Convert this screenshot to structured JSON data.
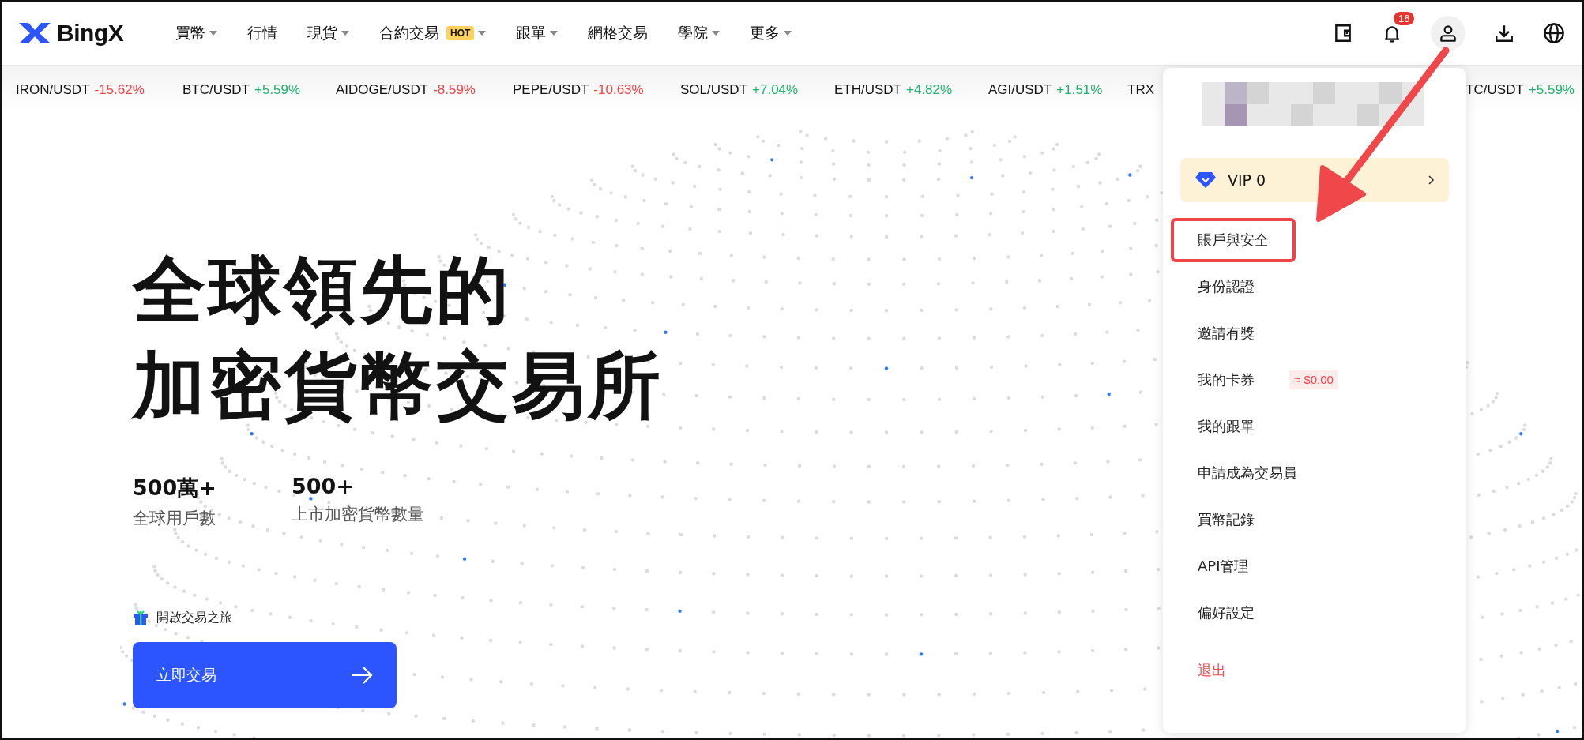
{
  "header": {
    "logo": "BingX",
    "nav": [
      {
        "label": "買幣",
        "has_menu": true
      },
      {
        "label": "行情",
        "has_menu": false
      },
      {
        "label": "現貨",
        "has_menu": true
      },
      {
        "label": "合約交易",
        "has_menu": true,
        "badge": "HOT"
      },
      {
        "label": "跟單",
        "has_menu": true
      },
      {
        "label": "網格交易",
        "has_menu": false
      },
      {
        "label": "學院",
        "has_menu": true
      },
      {
        "label": "更多",
        "has_menu": true
      }
    ],
    "notification_count": "16"
  },
  "ticker": [
    {
      "pair": "IRON/USDT",
      "change": "-15.62%",
      "color": "#ef454a"
    },
    {
      "pair": "BTC/USDT",
      "change": "+5.59%",
      "color": "#20b26c"
    },
    {
      "pair": "AIDOGE/USDT",
      "change": "-8.59%",
      "color": "#ef454a"
    },
    {
      "pair": "PEPE/USDT",
      "change": "-10.63%",
      "color": "#ef454a"
    },
    {
      "pair": "SOL/USDT",
      "change": "+7.04%",
      "color": "#20b26c"
    },
    {
      "pair": "ETH/USDT",
      "change": "+4.82%",
      "color": "#20b26c"
    },
    {
      "pair": "AGI/USDT",
      "change": "+1.51%",
      "color": "#20b26c"
    },
    {
      "pair": "TRX"
    },
    {
      "pair": "TC/USDT",
      "change": "+5.59%",
      "color": "#20b26c"
    }
  ],
  "hero": {
    "title_lines": [
      "全球領先的",
      "加密貨幣交易所"
    ],
    "stats": [
      {
        "value": "500萬+",
        "label": "全球用戶數"
      },
      {
        "value": "500+",
        "label": "上市加密貨幣數量"
      }
    ],
    "promo": "開啟交易之旅",
    "cta": "立即交易"
  },
  "account_menu": {
    "vip": "VIP 0",
    "items": [
      {
        "label": "賬戶與安全",
        "kind": "item",
        "highlighted": true
      },
      {
        "label": "身份認證",
        "kind": "item",
        "highlighted": false
      },
      {
        "label": "邀請有獎",
        "kind": "item",
        "highlighted": false
      },
      {
        "label": "我的卡券",
        "kind": "item",
        "highlighted": false,
        "badge": "≈ $0.00"
      },
      {
        "label": "我的跟單",
        "kind": "item",
        "highlighted": false
      },
      {
        "label": "申請成為交易員",
        "kind": "item",
        "highlighted": false
      },
      {
        "label": "買幣記錄",
        "kind": "item",
        "highlighted": false
      },
      {
        "label": "API管理",
        "kind": "item",
        "highlighted": false
      },
      {
        "label": "偏好設定",
        "kind": "item",
        "highlighted": false
      },
      {
        "label": "退出",
        "kind": "danger",
        "highlighted": false
      }
    ]
  }
}
